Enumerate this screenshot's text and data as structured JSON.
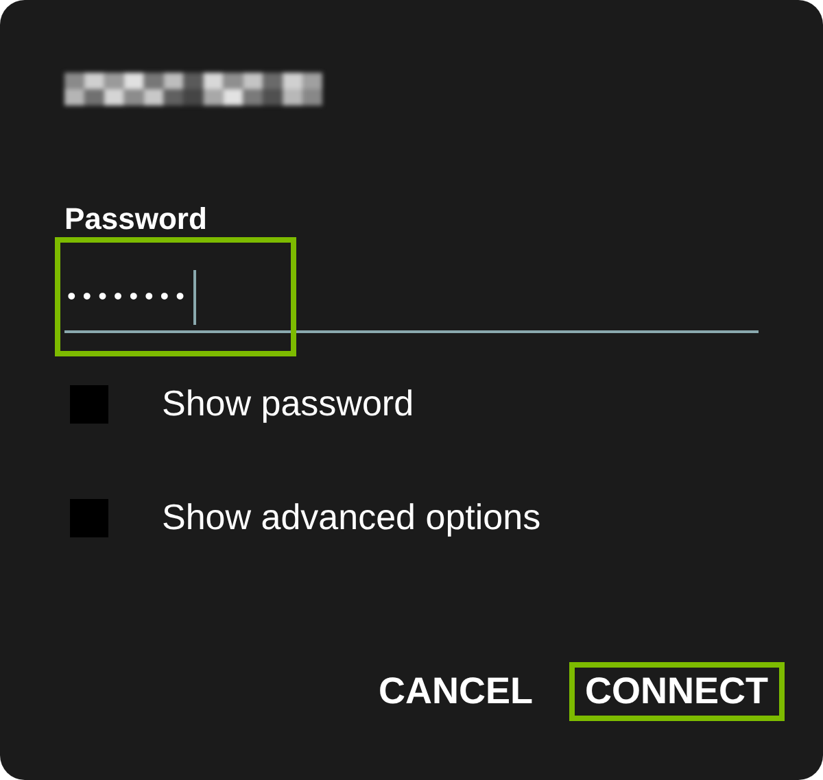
{
  "dialog": {
    "password": {
      "label": "Password",
      "value": "••••••••",
      "highlighted": true
    },
    "options": [
      {
        "label": "Show password",
        "checked": false
      },
      {
        "label": "Show advanced options",
        "checked": false
      }
    ],
    "buttons": [
      {
        "label": "CANCEL",
        "highlighted": false
      },
      {
        "label": "CONNECT",
        "highlighted": true
      }
    ]
  }
}
